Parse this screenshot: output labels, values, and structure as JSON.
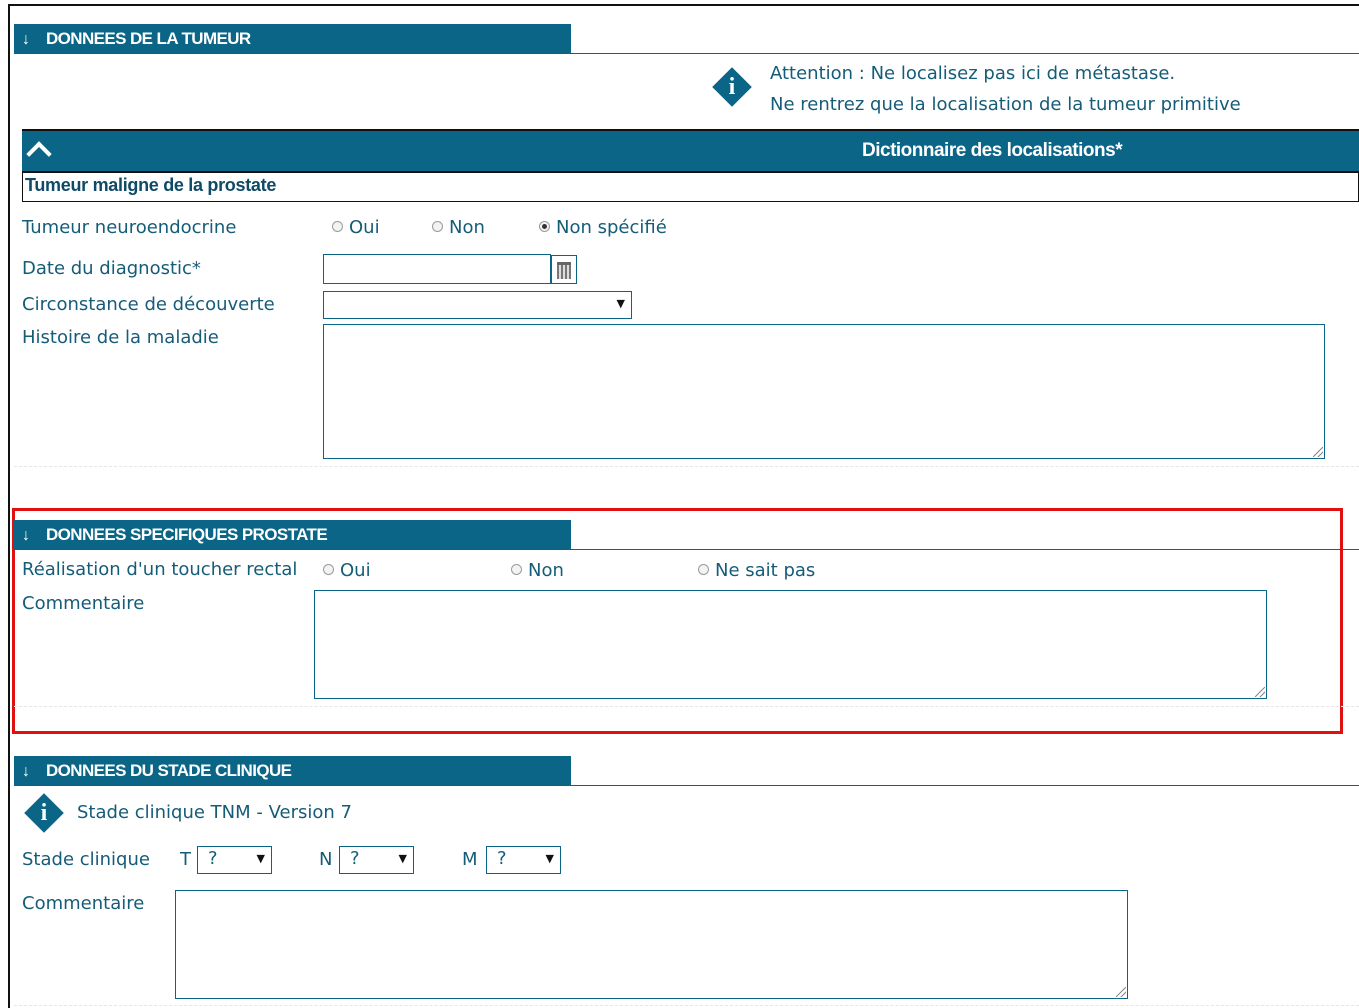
{
  "section_tumeur": {
    "title": "DONNEES DE LA TUMEUR",
    "attention_line1": "Attention : Ne localisez pas ici de métastase.",
    "attention_line2": "Ne rentrez que la localisation de la tumeur primitive",
    "dictionary_title": "Dictionnaire des localisations*",
    "localisation_value": "Tumeur maligne de la prostate",
    "neuroendocrine_label": "Tumeur neuroendocrine",
    "neuroendocrine_options": [
      "Oui",
      "Non",
      "Non spécifié"
    ],
    "neuroendocrine_selected": "Non spécifié",
    "date_label": "Date du diagnostic*",
    "date_value": "",
    "circonstance_label": "Circonstance de découverte",
    "circonstance_value": "",
    "histoire_label": "Histoire de la maladie",
    "histoire_value": ""
  },
  "section_prostate": {
    "title": "DONNEES SPECIFIQUES PROSTATE",
    "toucher_label": "Réalisation d'un toucher rectal",
    "toucher_options": [
      "Oui",
      "Non",
      "Ne sait pas"
    ],
    "commentaire_label": "Commentaire",
    "commentaire_value": ""
  },
  "section_stade": {
    "title": "DONNEES DU STADE CLINIQUE",
    "info_text": "Stade clinique TNM - Version 7",
    "stade_label": "Stade clinique",
    "t_label": "T",
    "t_value": "?",
    "n_label": "N",
    "n_value": "?",
    "m_label": "M",
    "m_value": "?",
    "commentaire_label": "Commentaire",
    "commentaire_value": ""
  },
  "colors": {
    "header_bg": "#0a6586",
    "text": "#155c78",
    "highlight_border": "#e01010"
  },
  "icons": [
    "arrow-down-icon",
    "info-icon",
    "chevron-up-icon",
    "calendar-icon",
    "dropdown-caret-icon"
  ]
}
